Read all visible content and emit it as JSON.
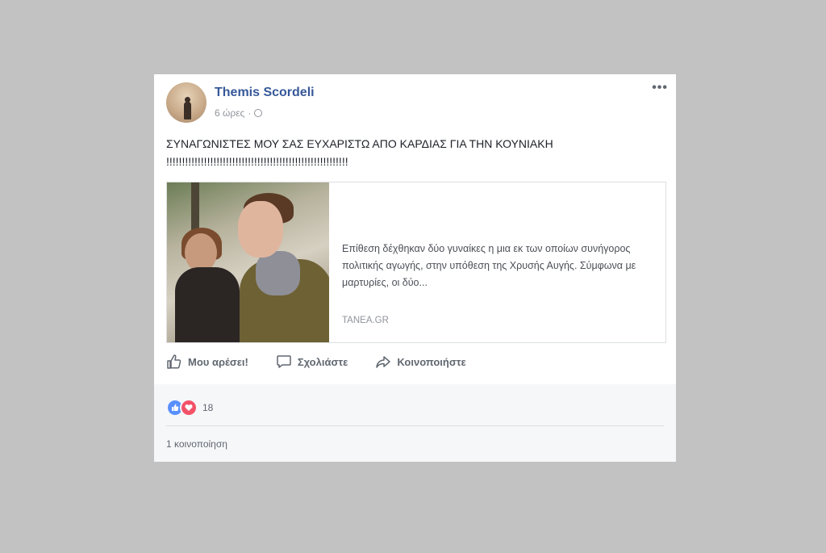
{
  "post": {
    "author": "Themis Scordeli",
    "time": "6 ώρες",
    "separator": "·",
    "privacy_icon": "globe-icon",
    "more_label": "•••",
    "text": "ΣΥΝΑΓΩΝΙΣΤΕΣ ΜΟΥ ΣΑΣ ΕΥΧΑΡΙΣΤΩ ΑΠΟ ΚΑΡΔΙΑΣ ΓΙΑ ΤΗΝ ΚΟΥΝΙΑΚΗ !!!!!!!!!!!!!!!!!!!!!!!!!!!!!!!!!!!!!!!!!!!!!!!!!!!!!!!!!!"
  },
  "link": {
    "description": "Επίθεση δέχθηκαν δύο γυναίκες η μια εκ των οποίων συνήγορος πολιτικής αγωγής, στην υπόθεση της Χρυσής Αυγής. Σύμφωνα με μαρτυρίες, οι δύο...",
    "domain": "TANEA.GR"
  },
  "actions": {
    "like": "Μου αρέσει!",
    "comment": "Σχολιάστε",
    "share": "Κοινοποιήστε"
  },
  "footer": {
    "reaction_count": "18",
    "shares": "1 κοινοποίηση"
  },
  "colors": {
    "background": "#c2c2c2",
    "author": "#365899",
    "like_reaction": "#5890ff",
    "love_reaction": "#f25268"
  }
}
